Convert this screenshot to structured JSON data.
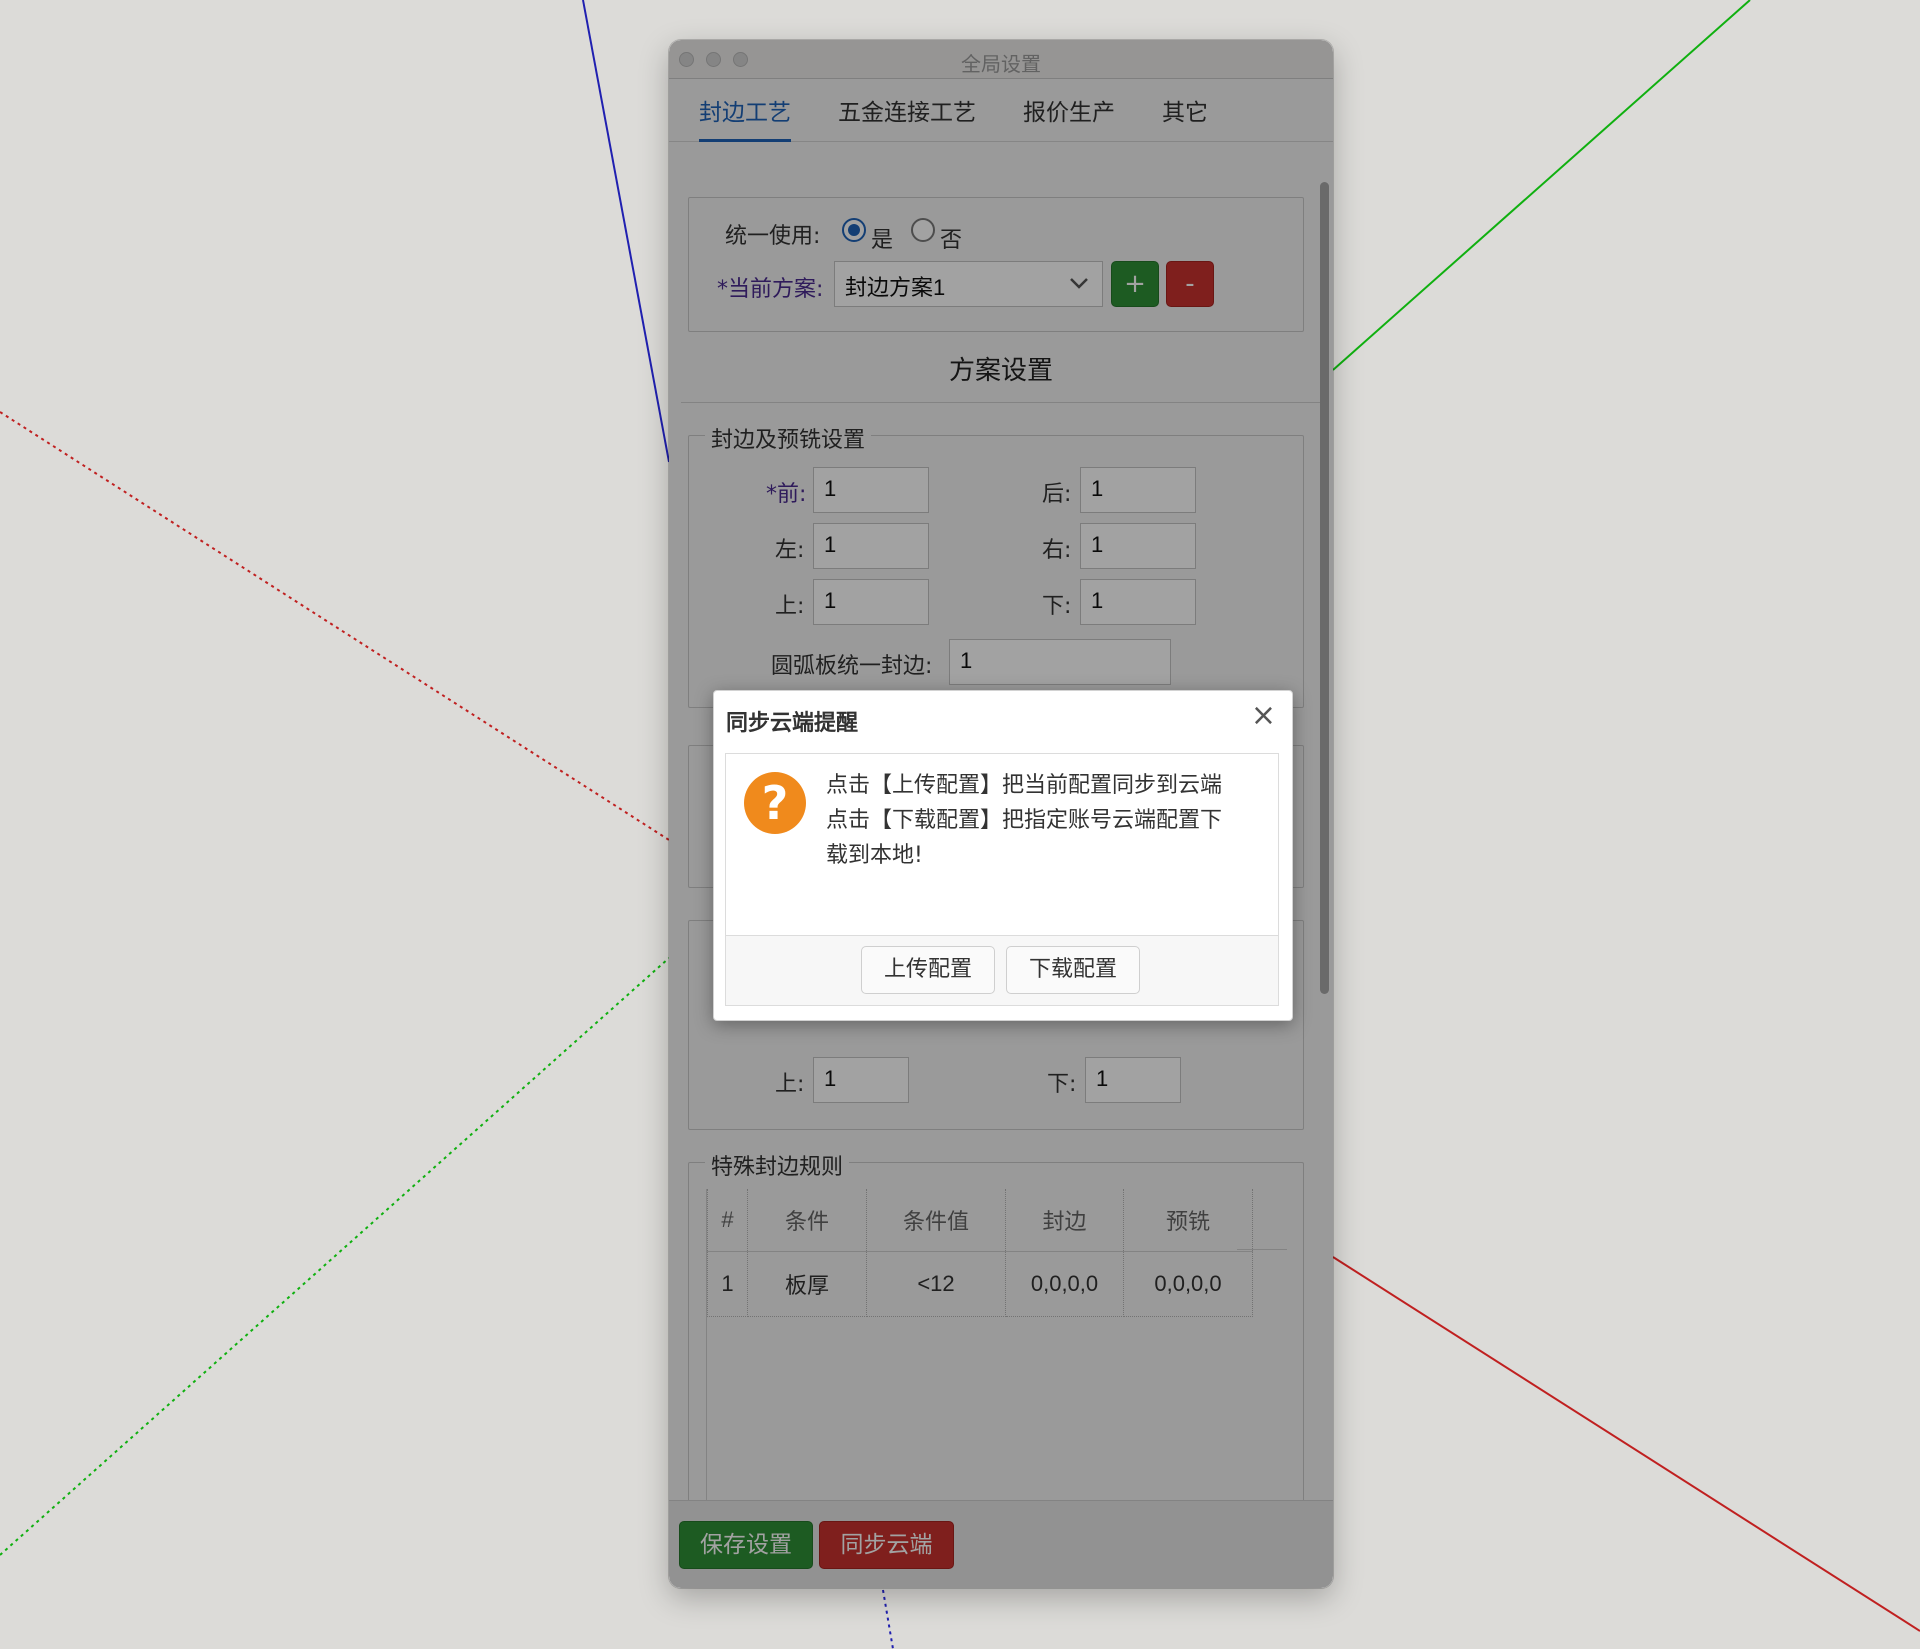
{
  "window": {
    "title": "全局设置"
  },
  "tabs": [
    "封边工艺",
    "五金连接工艺",
    "报价生产",
    "其它"
  ],
  "unified": {
    "label": "统一使用:",
    "yes": "是",
    "no": "否",
    "selected": "是"
  },
  "scheme": {
    "label": "*当前方案:",
    "value": "封边方案1",
    "add": "+",
    "remove": "-"
  },
  "section_title": "方案设置",
  "edge_group": {
    "legend": "封边及预铣设置",
    "front_label": "*前:",
    "front": "1",
    "back_label": "后:",
    "back": "1",
    "left_label": "左:",
    "left": "1",
    "right_label": "右:",
    "right": "1",
    "top_label": "上:",
    "top": "1",
    "bottom_label": "下:",
    "bottom": "1",
    "arc_label": "圆弧板统一封边:",
    "arc": "1"
  },
  "partial_group": {
    "top_label": "上:",
    "top": "1",
    "bottom_label": "下:",
    "bottom": "1"
  },
  "rules_group": {
    "legend": "特殊封边规则",
    "columns": [
      "#",
      "条件",
      "条件值",
      "封边",
      "预铣"
    ],
    "rows": [
      [
        "1",
        "板厚",
        "<12",
        "0,0,0,0",
        "0,0,0,0"
      ]
    ]
  },
  "footer": {
    "save": "保存设置",
    "sync": "同步云端"
  },
  "dialog": {
    "title": "同步云端提醒",
    "close": "×",
    "icon": "?",
    "line1": "点击【上传配置】把当前配置同步到云端",
    "line2": "点击【下载配置】把指定账号云端配置下",
    "line3": "载到本地!",
    "upload": "上传配置",
    "download": "下载配置"
  },
  "colors": {
    "accent": "#1e62b7",
    "success": "#2f8f36",
    "danger": "#c8322e",
    "warning_icon": "#f08a1c"
  }
}
